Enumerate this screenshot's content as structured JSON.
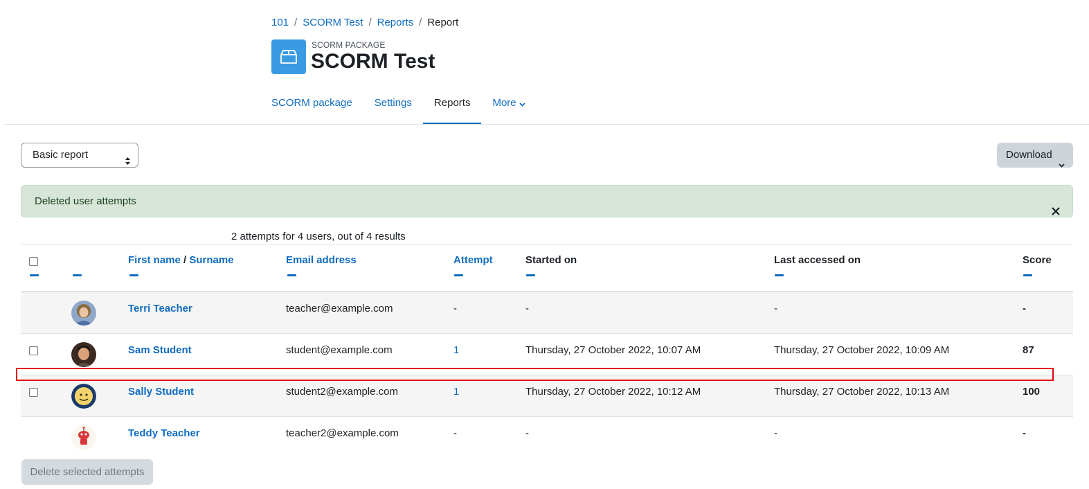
{
  "breadcrumb": [
    {
      "label": "101"
    },
    {
      "label": "SCORM Test"
    },
    {
      "label": "Reports"
    },
    {
      "label": "Report"
    }
  ],
  "header": {
    "kicker": "SCORM PACKAGE",
    "title": "SCORM Test",
    "icon": "package-icon",
    "accent": "#399be2"
  },
  "nav": {
    "items": [
      {
        "label": "SCORM package",
        "active": false
      },
      {
        "label": "Settings",
        "active": false
      },
      {
        "label": "Reports",
        "active": true
      },
      {
        "label": "More",
        "active": false
      }
    ]
  },
  "controls": {
    "report_select": "Basic report",
    "download_label": "Download"
  },
  "alert": {
    "message": "Deleted user attempts",
    "color": "#d7e6d8"
  },
  "summary": "2 attempts for 4 users, out of 4 results",
  "table": {
    "columns": {
      "first_name": "First name",
      "name_sep": "/",
      "surname": "Surname",
      "email": "Email address",
      "attempt": "Attempt",
      "started": "Started on",
      "last_accessed": "Last accessed on",
      "score": "Score"
    },
    "rows": [
      {
        "name": "Terri Teacher",
        "email": "teacher@example.com",
        "attempt": "-",
        "started": "-",
        "last_accessed": "-",
        "score": "-",
        "checkbox": false
      },
      {
        "name": "Sam Student",
        "email": "student@example.com",
        "attempt": "1",
        "started": "Thursday, 27 October 2022, 10:07 AM",
        "last_accessed": "Thursday, 27 October 2022, 10:09 AM",
        "score": "87",
        "checkbox": true
      },
      {
        "name": "Sally Student",
        "email": "student2@example.com",
        "attempt": "1",
        "started": "Thursday, 27 October 2022, 10:12 AM",
        "last_accessed": "Thursday, 27 October 2022, 10:13 AM",
        "score": "100",
        "checkbox": true
      },
      {
        "name": "Teddy Teacher",
        "email": "teacher2@example.com",
        "attempt": "-",
        "started": "-",
        "last_accessed": "-",
        "score": "-",
        "checkbox": false
      }
    ]
  },
  "footer": {
    "delete_label": "Delete selected attempts"
  }
}
